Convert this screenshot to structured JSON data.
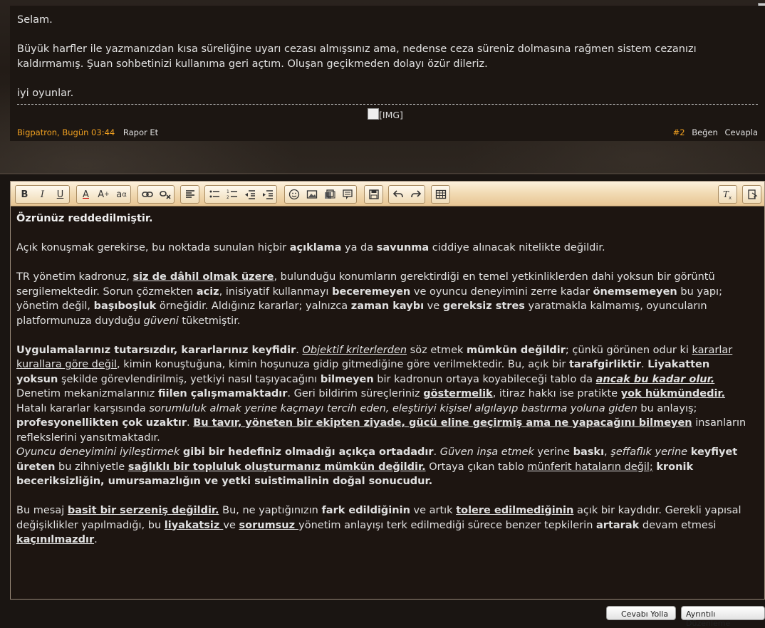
{
  "post": {
    "greeting": "Selam.",
    "body": "Büyük harfler ile yazmanızdan kısa süreliğine uyarı cezası almışsınız ama, nedense ceza süreniz dolmasına rağmen sistem cezanızı kaldırmamış. Şuan sohbetinizi kullanıma geri açtım. Oluşan geçikmeden dolayı özür dileriz.",
    "closing": "iyi oyunlar.",
    "image_alt": "[IMG]",
    "author_time": "Bigpatron, Bugün 03:44",
    "report": "Rapor Et",
    "post_number": "#2",
    "like": "Beğen",
    "reply": "Cevapla"
  },
  "toolbar": {
    "bold": "B",
    "italic": "I",
    "underline": "U",
    "font_color": "A",
    "font_size": "A",
    "font_family": "a",
    "link": "link",
    "unlink": "unlink",
    "align": "align",
    "bullet_list": "ul",
    "numbered_list": "ol",
    "outdent": "out",
    "indent": "in",
    "smilies": "smile",
    "image": "img",
    "media": "media",
    "quote": "quote",
    "save": "save",
    "undo": "undo",
    "redo": "redo",
    "table": "table",
    "remove_format": "Tx",
    "switch_mode": "mode"
  },
  "editor": {
    "p1": "Özrünüz reddedilmiştir.",
    "p2": [
      {
        "t": "Açık konuşmak gerekirse, bu noktada sunulan hiçbir "
      },
      {
        "t": "açıklama",
        "b": true
      },
      {
        "t": " ya da "
      },
      {
        "t": "savunma",
        "b": true
      },
      {
        "t": " ciddiye alınacak nitelikte değildir."
      }
    ],
    "p3": [
      {
        "t": "TR yönetim kadronuz, "
      },
      {
        "t": "siz de dâhil olmak üzere",
        "b": true,
        "u": true
      },
      {
        "t": ", bulunduğu konumların gerektirdiği en temel yetkinliklerden dahi yoksun bir görüntü sergilemektedir. Sorun çözmekten "
      },
      {
        "t": "aciz",
        "b": true
      },
      {
        "t": ", inisiyatif kullanmayı "
      },
      {
        "t": "beceremeyen",
        "b": true
      },
      {
        "t": " ve oyuncu deneyimini zerre kadar "
      },
      {
        "t": "önemsemeyen",
        "b": true
      },
      {
        "t": " bu yapı; yönetim değil, "
      },
      {
        "t": "başıboşluk",
        "b": true
      },
      {
        "t": " örneğidir. Aldığınız kararlar; yalnızca "
      },
      {
        "t": "zaman kaybı",
        "b": true
      },
      {
        "t": " ve "
      },
      {
        "t": "gereksiz stres",
        "b": true
      },
      {
        "t": " yaratmakla kalmamış, oyuncuların platformunuza duyduğu "
      },
      {
        "t": "güveni",
        "i": true
      },
      {
        "t": " tüketmiştir."
      }
    ],
    "p4": [
      {
        "t": "Uygulamalarınız tutarsızdır, kararlarınız keyfidir",
        "b": true
      },
      {
        "t": ". "
      },
      {
        "t": "Objektif kriterlerden",
        "i": true,
        "u": true
      },
      {
        "t": " söz etmek "
      },
      {
        "t": "mümkün değildir",
        "b": true
      },
      {
        "t": "; çünkü görünen odur ki "
      },
      {
        "t": "kararlar kurallara göre değil",
        "u": true
      },
      {
        "t": ", kimin konuştuğuna, kimin hoşunuza gidip gitmediğine göre verilmektedir. Bu, açık bir "
      },
      {
        "t": "tarafgirliktir",
        "b": true
      },
      {
        "t": ". "
      },
      {
        "t": "Liyakatten yoksun",
        "b": true
      },
      {
        "t": " şekilde görevlendirilmiş, yetkiyi nasıl taşıyacağını "
      },
      {
        "t": "bilmeyen",
        "b": true
      },
      {
        "t": " bir kadronun ortaya koyabileceği tablo da "
      },
      {
        "t": "ancak bu kadar olur.",
        "b": true,
        "i": true,
        "u": true
      },
      {
        "t": " Denetim mekanizmalarınız "
      },
      {
        "t": "fiilen çalışmamaktadır",
        "b": true
      },
      {
        "t": ". Geri bildirim süreçleriniz "
      },
      {
        "t": "göstermelik",
        "b": true,
        "u": true
      },
      {
        "t": ", itiraz hakkı ise pratikte "
      },
      {
        "t": "yok hükmündedir.",
        "b": true,
        "u": true
      },
      {
        "t": " Hatalı kararlar karşısında "
      },
      {
        "t": "sorumluluk almak yerine kaçmayı tercih eden, eleştiriyi kişisel algılayıp bastırma yoluna giden",
        "i": true
      },
      {
        "t": " bu anlayış; "
      },
      {
        "t": "profesyonellikten çok uzaktır",
        "b": true
      },
      {
        "t": ". "
      },
      {
        "t": "Bu tavır, yöneten bir ekipten ziyade, gücü eline geçirmiş ama ne yapacağını bilmeyen",
        "b": true,
        "u": true
      },
      {
        "t": " insanların reflekslerini yansıtmaktadır."
      }
    ],
    "p5": [
      {
        "t": "Oyuncu deneyimini iyileştirmek",
        "i": true
      },
      {
        "t": " "
      },
      {
        "t": "gibi bir hedefiniz olmadığı açıkça ortadadır",
        "b": true
      },
      {
        "t": ". "
      },
      {
        "t": "Güven inşa etmek",
        "i": true
      },
      {
        "t": " yerine "
      },
      {
        "t": "baskı",
        "b": true
      },
      {
        "t": ", "
      },
      {
        "t": "şeffaflık yerine",
        "i": true
      },
      {
        "t": " "
      },
      {
        "t": "keyfiyet üreten",
        "b": true
      },
      {
        "t": " bu zihniyetle "
      },
      {
        "t": "sağlıklı bir topluluk oluşturmanız mümkün değildir.",
        "b": true,
        "u": true
      },
      {
        "t": " Ortaya çıkan tablo "
      },
      {
        "t": "münferit hataların değil;",
        "u": true
      },
      {
        "t": " "
      },
      {
        "t": "kronik beceriksizliğin, umursamazlığın ve yetki suistimalinin doğal sonucudur.",
        "b": true
      }
    ],
    "p6": [
      {
        "t": "Bu mesaj "
      },
      {
        "t": "basit bir serzeniş değildir.",
        "b": true,
        "u": true
      },
      {
        "t": " Bu, ne yaptığınızın "
      },
      {
        "t": "fark edildiğinin",
        "b": true
      },
      {
        "t": " ve artık "
      },
      {
        "t": "tolere edilmediğinin",
        "b": true,
        "u": true
      },
      {
        "t": " açık bir kaydıdır. Gerekli yapısal değişiklikler yapılmadığı, bu "
      },
      {
        "t": "liyakatsiz ",
        "b": true,
        "u": true
      },
      {
        "t": "ve "
      },
      {
        "t": "sorumsuz ",
        "b": true,
        "u": true
      },
      {
        "t": "yönetim anlayışı terk edilmediği sürece benzer tepkilerin "
      },
      {
        "t": "artarak",
        "b": true
      },
      {
        "t": " devam etmesi "
      },
      {
        "t": "kaçınılmazdır",
        "b": true,
        "u": true
      },
      {
        "t": "."
      }
    ]
  },
  "buttons": {
    "send_reply": "Cevabı Yolla",
    "advanced_edit": "Ayrıntılı Düzenleme"
  }
}
